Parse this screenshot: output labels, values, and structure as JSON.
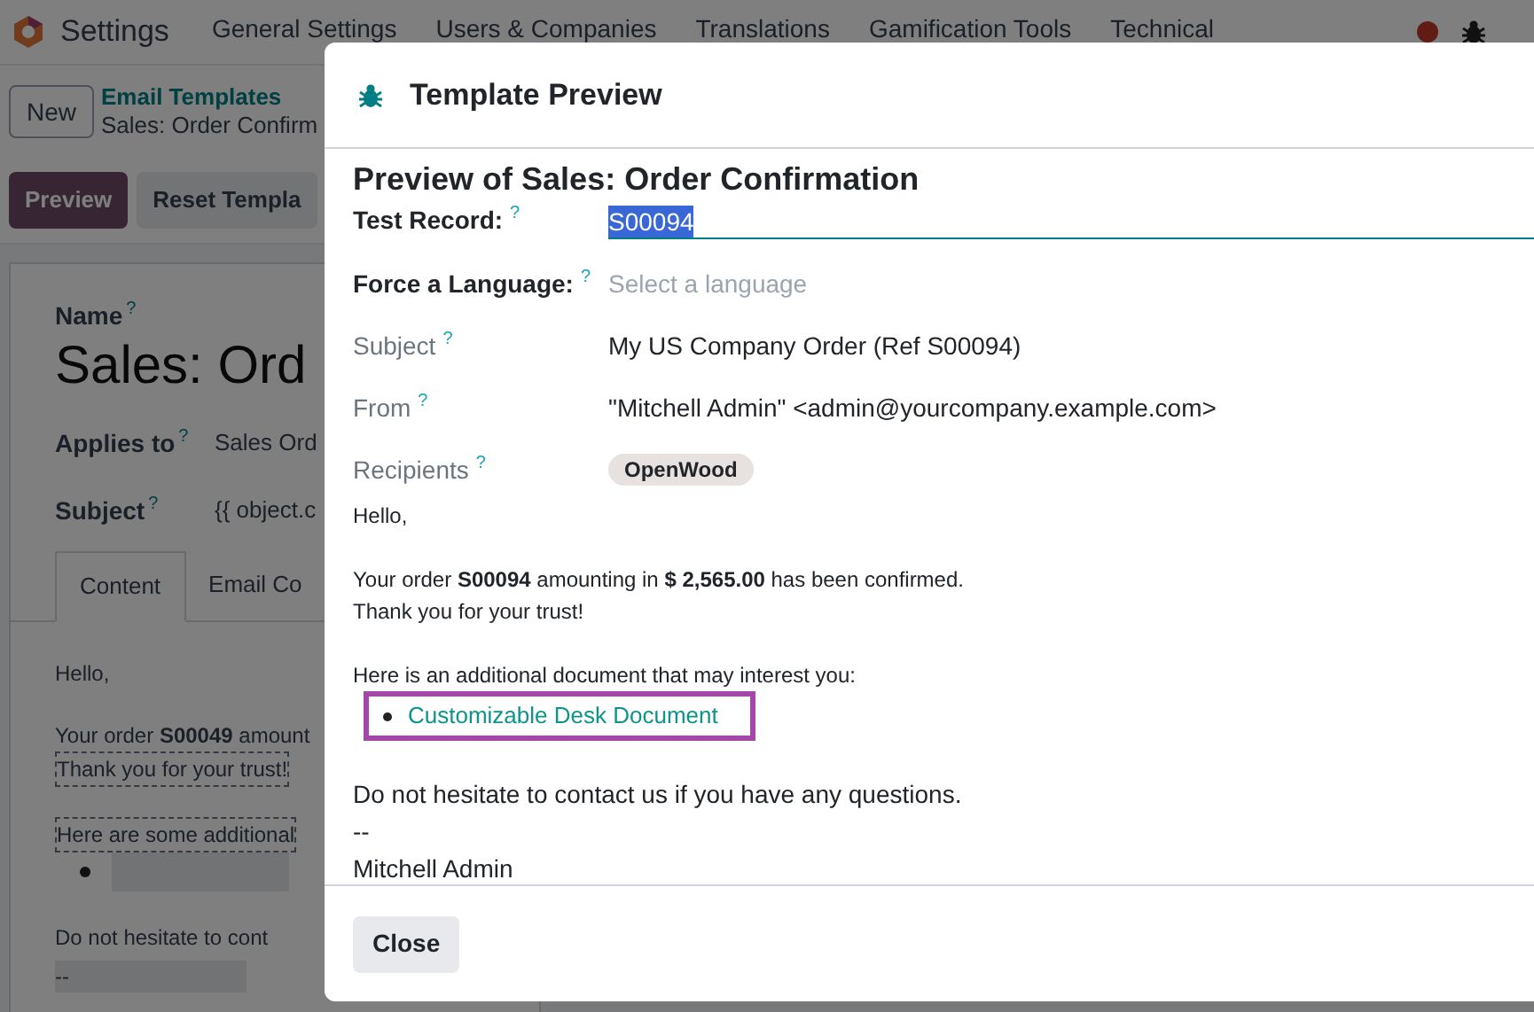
{
  "navbar": {
    "app": "Settings",
    "menu": [
      "General Settings",
      "Users & Companies",
      "Translations",
      "Gamification Tools",
      "Technical"
    ]
  },
  "control_panel": {
    "new_button": "New",
    "breadcrumb_parent": "Email Templates",
    "breadcrumb_current": "Sales: Order Confirm",
    "actions": [
      {
        "label": "Preview",
        "kind": "primary"
      },
      {
        "label": "Reset Templa",
        "kind": "secondary"
      }
    ]
  },
  "form": {
    "name_label": "Name",
    "name_help": "?",
    "name": "Sales: Ord",
    "fields": [
      {
        "label": "Applies to",
        "help": "?",
        "value": "Sales Ord"
      },
      {
        "label": "Subject",
        "help": "?",
        "value": "{{ object.c"
      }
    ],
    "tabs": [
      {
        "label": "Content",
        "selected": true
      },
      {
        "label": "Email Co",
        "selected": false
      }
    ],
    "body": [
      [
        {
          "kind": "plain",
          "text": "Hello,"
        }
      ],
      [
        {
          "kind": "plain",
          "text": "Your order **S00049** amount"
        },
        {
          "kind": "framed",
          "text": "Thank you for your trust!"
        }
      ],
      [
        {
          "kind": "framed",
          "text": "Here are some additional"
        },
        {
          "kind": "bullet"
        }
      ],
      [
        {
          "kind": "plain",
          "text": "Do not hesitate to cont"
        },
        {
          "kind": "shaded",
          "text": "--"
        }
      ]
    ]
  },
  "modal": {
    "title": "Template Preview",
    "heading": "Preview of Sales: Order Confirmation",
    "fields": [
      {
        "kind": "input",
        "label": "Test Record:",
        "help": "?",
        "value": "S00094"
      },
      {
        "kind": "select",
        "label": "Force a Language:",
        "help": "?",
        "placeholder": "Select a language"
      },
      {
        "kind": "readonly",
        "label": "Subject",
        "help": "?",
        "value": "My US Company Order (Ref S00094)"
      },
      {
        "kind": "readonly",
        "label": "From",
        "help": "?",
        "value": "\"Mitchell Admin\" <admin@yourcompany.example.com>"
      },
      {
        "kind": "tags",
        "label": "Recipients",
        "help": "?",
        "tags": [
          "OpenWood"
        ]
      }
    ],
    "email": [
      {
        "kind": "small",
        "lines": [
          "Hello,"
        ]
      },
      {
        "kind": "small",
        "lines": [
          "Your order **S00094** amounting in **$ 2,565.00** has been confirmed.",
          "Thank you for your trust!"
        ]
      },
      {
        "kind": "small",
        "lines": [
          "Here is an additional document that may interest you:"
        ]
      },
      {
        "kind": "links",
        "links": [
          "Customizable Desk Document"
        ],
        "highlighted": true
      },
      {
        "kind": "large",
        "lines": [
          "Do not hesitate to contact us if you have any questions.",
          "--",
          "Mitchell Admin"
        ]
      }
    ],
    "buttons": [
      "Close"
    ]
  }
}
